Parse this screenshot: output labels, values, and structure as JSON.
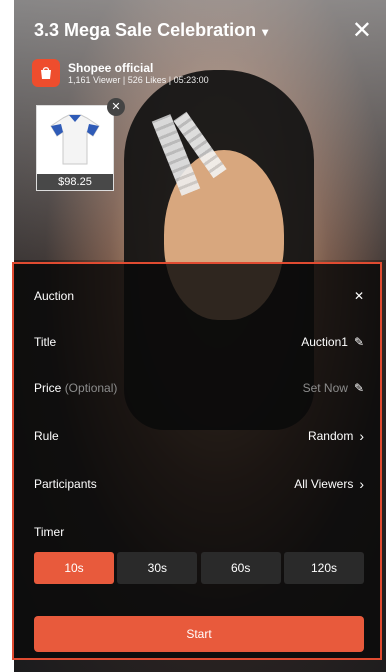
{
  "header": {
    "title": "3.3 Mega Sale Celebration",
    "title_chevron": "▾",
    "close": "✕"
  },
  "shop": {
    "icon": "shopee-bag-icon",
    "name": "Shopee official",
    "stats": "1,161 Viewer | 526 Likes | 05:23:00"
  },
  "product": {
    "price": "$98.25",
    "close": "✕"
  },
  "auction_panel": {
    "header": "Auction",
    "close": "✕",
    "rows": {
      "title": {
        "label": "Title",
        "value": "Auction1",
        "icon": "pencil-icon"
      },
      "price": {
        "label": "Price",
        "optional": "(Optional)",
        "value": "Set Now",
        "icon": "pencil-icon"
      },
      "rule": {
        "label": "Rule",
        "value": "Random",
        "icon": "chevron-right-icon"
      },
      "participants": {
        "label": "Participants",
        "value": "All Viewers",
        "icon": "chevron-right-icon"
      }
    },
    "timer_label": "Timer",
    "timers": [
      "10s",
      "30s",
      "60s",
      "120s"
    ],
    "active_timer": "10s",
    "start_label": "Start"
  },
  "colors": {
    "accent": "#e85a3c",
    "panel_border": "#e04b31",
    "panel_bg": "#0a0a0a"
  }
}
